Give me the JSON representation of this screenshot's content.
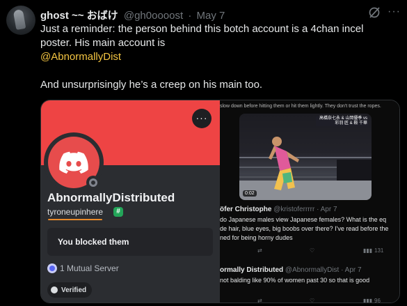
{
  "post": {
    "author_name": "ghost ~~ おばけ",
    "author_handle": "@gh0oooost",
    "separator": "·",
    "time": "May 7",
    "more": "···",
    "text_line1": "Just a reminder: the person behind this botch account is a 4chan incel",
    "text_line2": "poster. His main account is",
    "mention": "@AbnormallyDist",
    "text_line3": "And unsurprisingly he’s a creep on his main too."
  },
  "discord": {
    "menu": "···",
    "username": "AbnormallyDistributed",
    "tag": "tyroneupinhere",
    "badge": "#",
    "blocked_label": "You blocked them",
    "mutual_label": "1 Mutual Server",
    "verified_label": "Verified"
  },
  "twitter_screenshot": {
    "top_text": "slow down before hitting them or hit them lightly. They don't trust the ropes.",
    "video_banner": "高橋奈七永 & 山岡優季 vs 彩羽 匠 & 鞍 千華",
    "video_duration": "0:02",
    "reply1": {
      "name": "öfer Christophe",
      "handle": "@kristoferrrrr",
      "time": "· Apr 7",
      "lines": [
        "do Japanese males view Japanese females? What is the eq",
        "de hair, blue eyes, big boobs over there? I've read before the",
        "ned for being horny dudes"
      ],
      "views": "131"
    },
    "reply2": {
      "name": "ormally Distributed",
      "handle": "@AbnormallyDist",
      "time": "· Apr 7",
      "lines": [
        "not balding like 90% of women past 30 so that is good"
      ],
      "views": "96"
    }
  },
  "colors": {
    "mention": "#f4c542",
    "discord_banner": "#ee4444",
    "discord_card": "#2b2d31",
    "underline": "#e88a2b"
  }
}
